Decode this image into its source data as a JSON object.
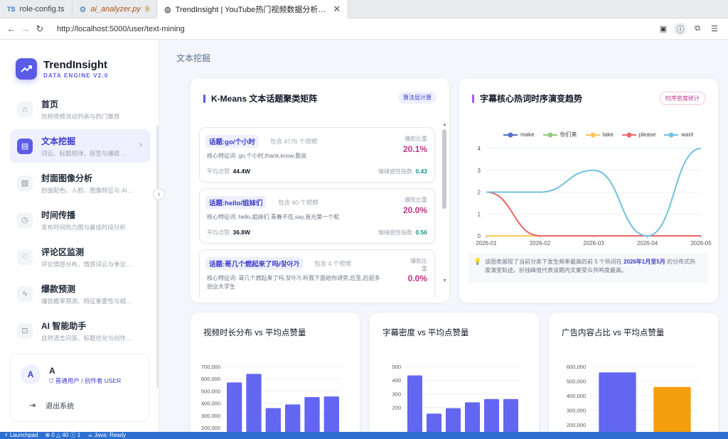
{
  "editor_tabs": [
    {
      "badge": "TS",
      "name": "role-config.ts"
    },
    {
      "badge": "⚙",
      "name": "ai_analyzer.py",
      "count": "9"
    },
    {
      "name": "TrendInsight | YouTube热门视频数据分析…"
    }
  ],
  "browser": {
    "url": "http://localhost:5000/user/text-mining"
  },
  "brand": {
    "name": "TrendInsight",
    "subtitle": "DATA ENGINE V2.0"
  },
  "menu": [
    {
      "title": "首页",
      "desc": "热榜视频流动列表与热门推荐"
    },
    {
      "title": "文本挖掘",
      "desc": "词云、标题规律、标签与爆款…"
    },
    {
      "title": "封面图像分析",
      "desc": "封面配色、人脸、图像特征与 AI 优…"
    },
    {
      "title": "时间传播",
      "desc": "发布时间热力图与最佳时段分析"
    },
    {
      "title": "评论区监测",
      "desc": "评论情感分布、情感词云与争议视…"
    },
    {
      "title": "爆款预测",
      "desc": "爆款概率预测、特征重要性与相似…"
    },
    {
      "title": "AI 智能助手",
      "desc": "自然语言问答、标题优化与创作策…"
    }
  ],
  "user": {
    "initial": "A",
    "name": "A",
    "role": "普通用户 / 创作者 USER",
    "logout": "退出系统"
  },
  "page_title": "文本挖掘",
  "kmeans": {
    "title": "K-Means 文本话题聚类矩阵",
    "tag": "算法层计算",
    "ratio_label": "爆款比重",
    "kw_prefix": "核心特征词:",
    "avg_label": "平均点赞:",
    "sent_label": "情绪感性指数:",
    "topics": [
      {
        "label": "话题:go/个小时",
        "count": "包含 4776 个视频",
        "kw": "go,个小时,thank,know,我说",
        "ratio": "20.1%",
        "avg": "44.4W",
        "sent": "0.43"
      },
      {
        "label": "话题:hello/姐妹们",
        "count": "包含 40 个视频",
        "kw": "hello,姐妹们,青春不在,say,音光第一个呢",
        "ratio": "20.0%",
        "avg": "36.8W",
        "sent": "0.56"
      },
      {
        "label": "话题:哥几个燃起来了吗/찾아가",
        "count": "包含 4 个视频",
        "kw": "哥几个燃起来了吗,찾아가,听我下面给你讲完,后至,后迎多创业大学生",
        "ratio": "0.0%"
      }
    ]
  },
  "trend": {
    "title": "字幕核心热词时序演变趋势",
    "tag": "时序密度统计",
    "note_parts": [
      "该图表展现了当前分类下发生频率最高的前 5 个热词在 ",
      "2026年1月至5月",
      " 的分布式热度演变轨迹。折线峰值代表该期内文案受众共鸣度最高。"
    ]
  },
  "bottom_titles": [
    "视频时长分布 vs 平均点赞量",
    "字幕密度 vs 平均点赞量",
    "广告内容占比 vs 平均点赞量"
  ],
  "chart_data": [
    {
      "type": "line",
      "x": [
        "2026-01",
        "2026-02",
        "2026-03",
        "2026-04",
        "2026-05"
      ],
      "ylim": [
        0,
        4
      ],
      "yticks": [
        "0",
        "1",
        "2",
        "3",
        "4"
      ],
      "grid": true,
      "legend_position": "top",
      "series": [
        {
          "name": "make",
          "color": "#5470c6",
          "values": [
            0,
            0,
            0,
            0,
            0
          ]
        },
        {
          "name": "你们来",
          "color": "#91cc75",
          "values": [
            0,
            0,
            0,
            0,
            0
          ]
        },
        {
          "name": "take",
          "color": "#fac858",
          "values": [
            0,
            0,
            0,
            0,
            0
          ]
        },
        {
          "name": "please",
          "color": "#ee6666",
          "values": [
            2,
            0,
            0,
            0,
            0
          ]
        },
        {
          "name": "want",
          "color": "#73c0de",
          "values": [
            2,
            2,
            3,
            0,
            4
          ]
        }
      ]
    },
    {
      "type": "bar",
      "color": "#6366f1",
      "categories": [
        "",
        "",
        "",
        "",
        "",
        ""
      ],
      "values": [
        570000,
        640000,
        360000,
        390000,
        450000,
        455000
      ],
      "ylim": [
        200000,
        700000
      ],
      "yticks": [
        "200,000",
        "300,000",
        "400,000",
        "500,000",
        "600,000",
        "700,000"
      ]
    },
    {
      "type": "bar",
      "color": "#6366f1",
      "categories": [
        "",
        "",
        "",
        "",
        "",
        ""
      ],
      "values": [
        435,
        155,
        195,
        238,
        262,
        262
      ],
      "ylim": [
        120,
        500
      ],
      "yticks": [
        "200",
        "300",
        "400",
        "500"
      ]
    },
    {
      "type": "bar",
      "colors": [
        "#6366f1",
        "#f59e0b"
      ],
      "categories": [
        "",
        ""
      ],
      "values": [
        560000,
        460000
      ],
      "ylim": [
        200000,
        600000
      ],
      "yticks": [
        "200,000",
        "300,000",
        "400,000",
        "500,000",
        "600,000"
      ]
    }
  ],
  "status": {
    "items": [
      "⚡ Launchpad",
      "⊗ 0 △ 40 ⓘ 1",
      "☕ Java: Ready"
    ]
  }
}
